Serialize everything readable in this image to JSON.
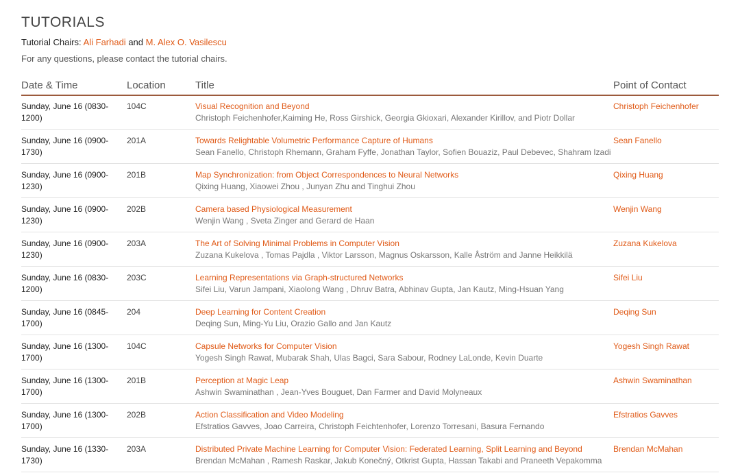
{
  "page": {
    "title": "TUTORIALS",
    "chairs_label": "Tutorial Chairs:",
    "chair_1": "Ali Farhadi",
    "chairs_and": "and",
    "chair_2": "M. Alex O. Vasilescu",
    "question": "For any questions, please contact the tutorial chairs."
  },
  "table": {
    "headers": {
      "date": "Date & Time",
      "location": "Location",
      "title": "Title",
      "contact": "Point of Contact"
    },
    "rows": [
      {
        "date": "Sunday, June 16 (0830-1200)",
        "location": "104C",
        "title": "Visual Recognition and Beyond",
        "authors": "Christoph Feichenhofer,Kaiming He, Ross Girshick, Georgia Gkioxari, Alexander Kirillov, and Piotr Dollar",
        "contact": "Christoph Feichenhofer"
      },
      {
        "date": "Sunday, June 16 (0900-1730)",
        "location": "201A",
        "title": "Towards Relightable Volumetric Performance Capture of Humans",
        "authors": "Sean Fanello, Christoph Rhemann, Graham Fyffe, Jonathan Taylor, Sofien Bouaziz, Paul Debevec, Shahram Izadi",
        "contact": "Sean Fanello"
      },
      {
        "date": "Sunday, June 16 (0900-1230)",
        "location": "201B",
        "title": "Map Synchronization: from Object Correspondences to Neural Networks",
        "authors": "Qixing Huang, Xiaowei Zhou , Junyan Zhu and Tinghui Zhou",
        "contact": "Qixing Huang"
      },
      {
        "date": "Sunday, June 16 (0900-1230)",
        "location": "202B",
        "title": "Camera based Physiological Measurement",
        "authors": "Wenjin Wang , Sveta Zinger and Gerard de Haan",
        "contact": "Wenjin Wang"
      },
      {
        "date": "Sunday, June 16 (0900-1230)",
        "location": "203A",
        "title": "The Art of Solving Minimal Problems in Computer Vision",
        "authors": "Zuzana Kukelova , Tomas Pajdla , Viktor Larsson, Magnus Oskarsson, Kalle Åström and Janne Heikkilä",
        "contact": "Zuzana Kukelova"
      },
      {
        "date": "Sunday, June 16 (0830-1200)",
        "location": "203C",
        "title": "Learning Representations via Graph-structured Networks",
        "authors": "Sifei Liu, Varun Jampani,  Xiaolong Wang , Dhruv Batra, Abhinav Gupta, Jan Kautz, Ming-Hsuan Yang",
        "contact": "Sifei Liu"
      },
      {
        "date": "Sunday, June 16 (0845-1700)",
        "location": "204",
        "title": "Deep Learning for Content Creation",
        "authors": "Deqing Sun, Ming-Yu Liu, Orazio Gallo and Jan Kautz",
        "contact": "Deqing Sun"
      },
      {
        "date": "Sunday, June 16 (1300-1700)",
        "location": "104C",
        "title": "Capsule Networks for Computer Vision",
        "authors": "Yogesh Singh Rawat, Mubarak Shah, Ulas Bagci, Sara Sabour, Rodney LaLonde, Kevin Duarte",
        "contact": "Yogesh Singh Rawat"
      },
      {
        "date": "Sunday, June 16 (1300-1700)",
        "location": "201B",
        "title": "Perception at Magic Leap",
        "authors": "Ashwin Swaminathan , Jean-Yves Bouguet, Dan Farmer and David Molyneaux",
        "contact": "Ashwin Swaminathan"
      },
      {
        "date": "Sunday, June 16 (1300-1700)",
        "location": "202B",
        "title": "Action Classification and Video Modeling",
        "authors": "Efstratios Gavves, Joao Carreira, Christoph Feichtenhofer, Lorenzo Torresani, Basura Fernando",
        "contact": "Efstratios Gavves"
      },
      {
        "date": "Sunday, June 16 (1330-1730)",
        "location": "203A",
        "title": "Distributed Private Machine Learning for Computer Vision: Federated Learning, Split Learning and Beyond",
        "authors": "Brendan McMahan , Ramesh Raskar, Jakub Konečný, Otkrist Gupta, Hassan Takabi  and Praneeth Vepakomma",
        "contact": "Brendan McMahan"
      }
    ]
  },
  "colors": {
    "link": "#e05a17",
    "header_rule": "#9c5a3c"
  }
}
